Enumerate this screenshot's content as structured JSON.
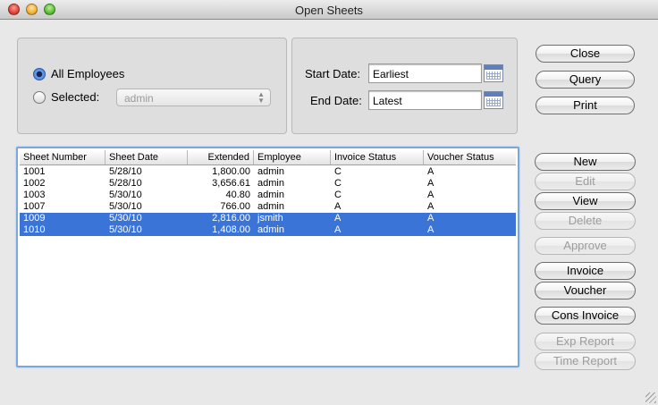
{
  "window": {
    "title": "Open Sheets"
  },
  "filter": {
    "all_employees_label": "All Employees",
    "selected_label": "Selected:",
    "employee_select_value": "admin",
    "mode": "all"
  },
  "dates": {
    "start_label": "Start Date:",
    "start_value": "Earliest",
    "end_label": "End Date:",
    "end_value": "Latest"
  },
  "top_buttons": [
    {
      "label": "Close",
      "enabled": true
    },
    {
      "label": "Query",
      "enabled": true
    },
    {
      "label": "Print",
      "enabled": true
    }
  ],
  "side_buttons": [
    {
      "label": "New",
      "enabled": true
    },
    {
      "label": "Edit",
      "enabled": false
    },
    {
      "label": "View",
      "enabled": true
    },
    {
      "label": "Delete",
      "enabled": false
    },
    {
      "label": "Approve",
      "enabled": false
    },
    {
      "label": "Invoice",
      "enabled": true
    },
    {
      "label": "Voucher",
      "enabled": true
    },
    {
      "label": "Cons Invoice",
      "enabled": true
    },
    {
      "label": "Exp Report",
      "enabled": false
    },
    {
      "label": "Time Report",
      "enabled": false
    }
  ],
  "table": {
    "columns": [
      "Sheet Number",
      "Sheet Date",
      "Extended",
      "Employee",
      "Invoice Status",
      "Voucher Status"
    ],
    "rows": [
      {
        "cells": [
          "1001",
          "5/28/10",
          "1,800.00",
          "admin",
          "C",
          "A"
        ],
        "selected": false
      },
      {
        "cells": [
          "1002",
          "5/28/10",
          "3,656.61",
          "admin",
          "C",
          "A"
        ],
        "selected": false
      },
      {
        "cells": [
          "1003",
          "5/30/10",
          "40.80",
          "admin",
          "C",
          "A"
        ],
        "selected": false
      },
      {
        "cells": [
          "1007",
          "5/30/10",
          "766.00",
          "admin",
          "A",
          "A"
        ],
        "selected": false
      },
      {
        "cells": [
          "1009",
          "5/30/10",
          "2,816.00",
          "jsmith",
          "A",
          "A"
        ],
        "selected": true
      },
      {
        "cells": [
          "1010",
          "5/30/10",
          "1,408.00",
          "admin",
          "A",
          "A"
        ],
        "selected": true
      }
    ]
  }
}
